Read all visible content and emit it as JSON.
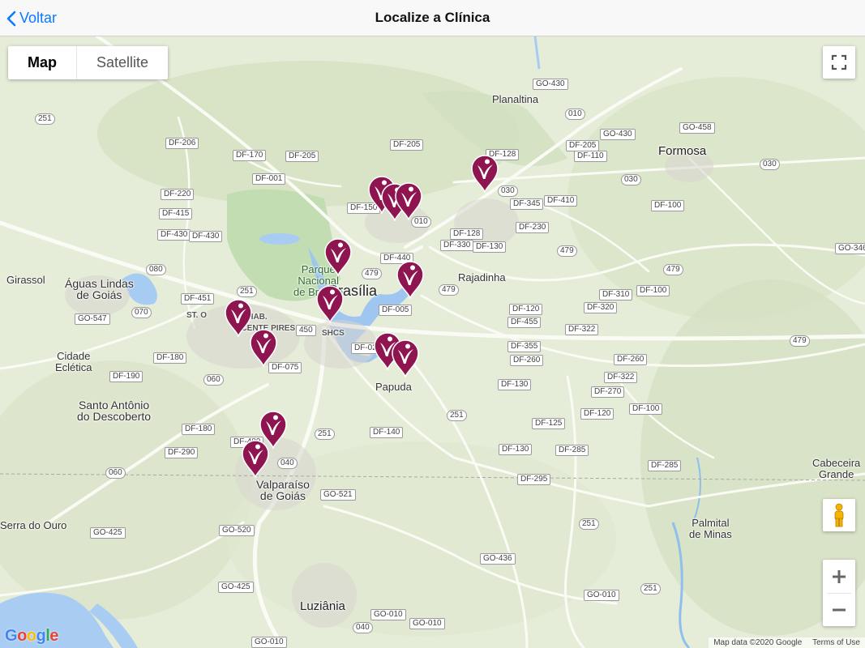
{
  "nav": {
    "back_label": "Voltar",
    "title": "Localize a Clínica"
  },
  "map_type": {
    "map_label": "Map",
    "satellite_label": "Satellite",
    "active": "Map"
  },
  "brand_color": "#8e1550",
  "attribution": {
    "data": "Map data ©2020 Google",
    "terms": "Terms of Use",
    "logo": "Google"
  },
  "places": {
    "planaltina": "Planaltina",
    "formosa": "Formosa",
    "girassol": "Girassol",
    "aguas_lindas": "Águas Lindas\nde Goiás",
    "rajadinha": "Rajadinha",
    "parque_nacional": "Parque\nNacional\nde Brasília",
    "brasilia": "Brasília",
    "shcs": "SHCS",
    "st_o": "ST. O",
    "vicente_pires": "ST. HAB.\nVICENTE PIRES",
    "cidade_ecletica": "Cidade\nEclética",
    "santo_antonio": "Santo Antônio\ndo Descoberto",
    "papuda": "Papuda",
    "valparaiso": "Valparaíso\nde Goiás",
    "serra_do_ouro": "Serra do Ouro",
    "cabeceira_grande": "Cabeceira\nGrande",
    "palmital": "Palmital\nde Minas",
    "luziania": "Luziânia"
  },
  "roads": {
    "go430": "GO-430",
    "r010a": "010",
    "go430b": "GO-430",
    "go458": "GO-458",
    "r251a": "251",
    "df206": "DF-206",
    "df170": "DF-170",
    "df205a": "DF-205",
    "df205b": "DF-205",
    "df128a": "DF-128",
    "df205c": "DF-205",
    "df110": "DF-110",
    "df001": "DF-001",
    "r030a": "030",
    "r030b": "030",
    "df220": "DF-220",
    "df150": "DF-150",
    "r010b": "010",
    "df345": "DF-345",
    "df410": "DF-410",
    "df100a": "DF-100",
    "df415": "DF-415",
    "df430a": "DF-430",
    "df430b": "DF-430",
    "df128b": "DF-128",
    "df230": "DF-230",
    "df330": "DF-330",
    "df130a": "DF-130",
    "go346": "GO-346",
    "r479a": "479",
    "df440": "DF-440",
    "r080": "080",
    "r479b": "479",
    "r479c": "479",
    "df451": "DF-451",
    "r251b": "251",
    "df310": "DF-310",
    "df100b": "DF-100",
    "r070": "070",
    "df005": "DF-005",
    "df120a": "DF-120",
    "df320": "DF-320",
    "go547": "GO-547",
    "r450": "450",
    "df455": "DF-455",
    "df322a": "DF-322",
    "df355": "DF-355",
    "df025": "DF-025",
    "df260a": "DF-260",
    "df180a": "DF-180",
    "df260b": "DF-260",
    "df075": "DF-075",
    "r479d": "479",
    "df190": "DF-190",
    "r060a": "060",
    "df322b": "DF-322",
    "df130b": "DF-130",
    "df270": "DF-270",
    "df100c": "DF-100",
    "r251c": "251",
    "df120b": "DF-120",
    "df125": "DF-125",
    "df180b": "DF-180",
    "df140": "DF-140",
    "df480": "DF-480",
    "df290": "DF-290",
    "r251d": "251",
    "df130c": "DF-130",
    "df285a": "DF-285",
    "r040": "040",
    "df285b": "DF-285",
    "r060b": "060",
    "df295": "DF-295",
    "go521": "GO-521",
    "r251e": "251",
    "go425a": "GO-425",
    "go520": "GO-520",
    "go436": "GO-436",
    "go425b": "GO-425",
    "r251f": "251",
    "go010a": "GO-010",
    "go010b": "GO-010",
    "r040b": "040",
    "go010c": "GO-010",
    "go010d": "GO-010"
  }
}
